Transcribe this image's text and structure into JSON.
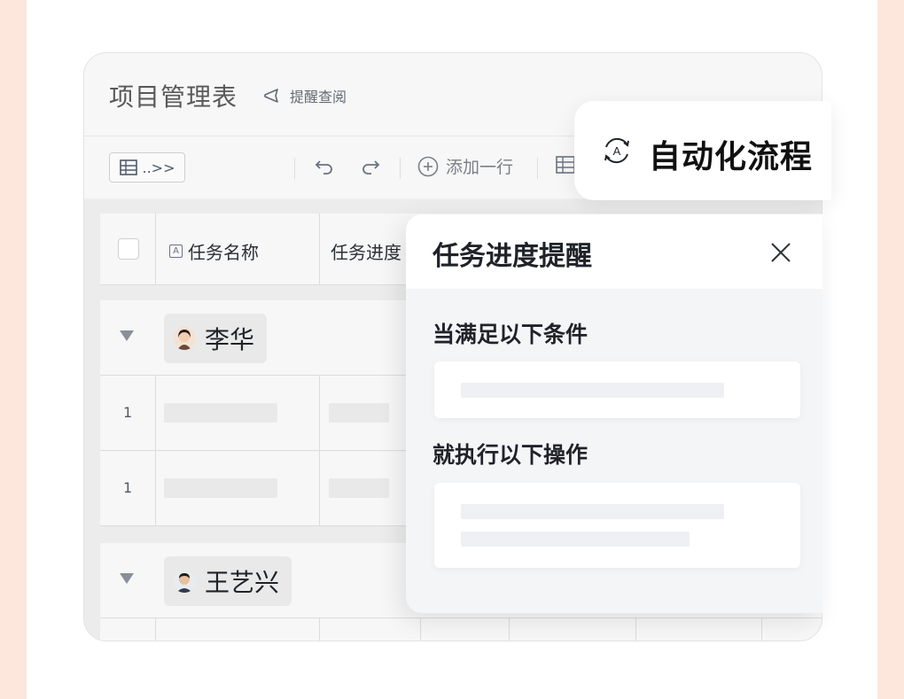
{
  "app": {
    "title": "项目管理表",
    "remind_label": "提醒查阅"
  },
  "toolbar": {
    "view_label": "..>>",
    "add_row_label": "添加一行"
  },
  "table": {
    "columns": [
      {
        "label": "任务名称"
      },
      {
        "label": "任务进度"
      }
    ],
    "groups": [
      {
        "name": "李华",
        "rows": [
          "1",
          "1"
        ]
      },
      {
        "name": "王艺兴"
      }
    ]
  },
  "automation": {
    "title": "自动化流程",
    "icon": "auto-flow-icon"
  },
  "reminder_panel": {
    "title": "任务进度提醒",
    "condition_label": "当满足以下条件",
    "action_label": "就执行以下操作"
  },
  "colors": {
    "background": "#fde6dc",
    "card": "#f0f0f0",
    "panel": "#f4f5f7",
    "text": "#1f2329"
  }
}
